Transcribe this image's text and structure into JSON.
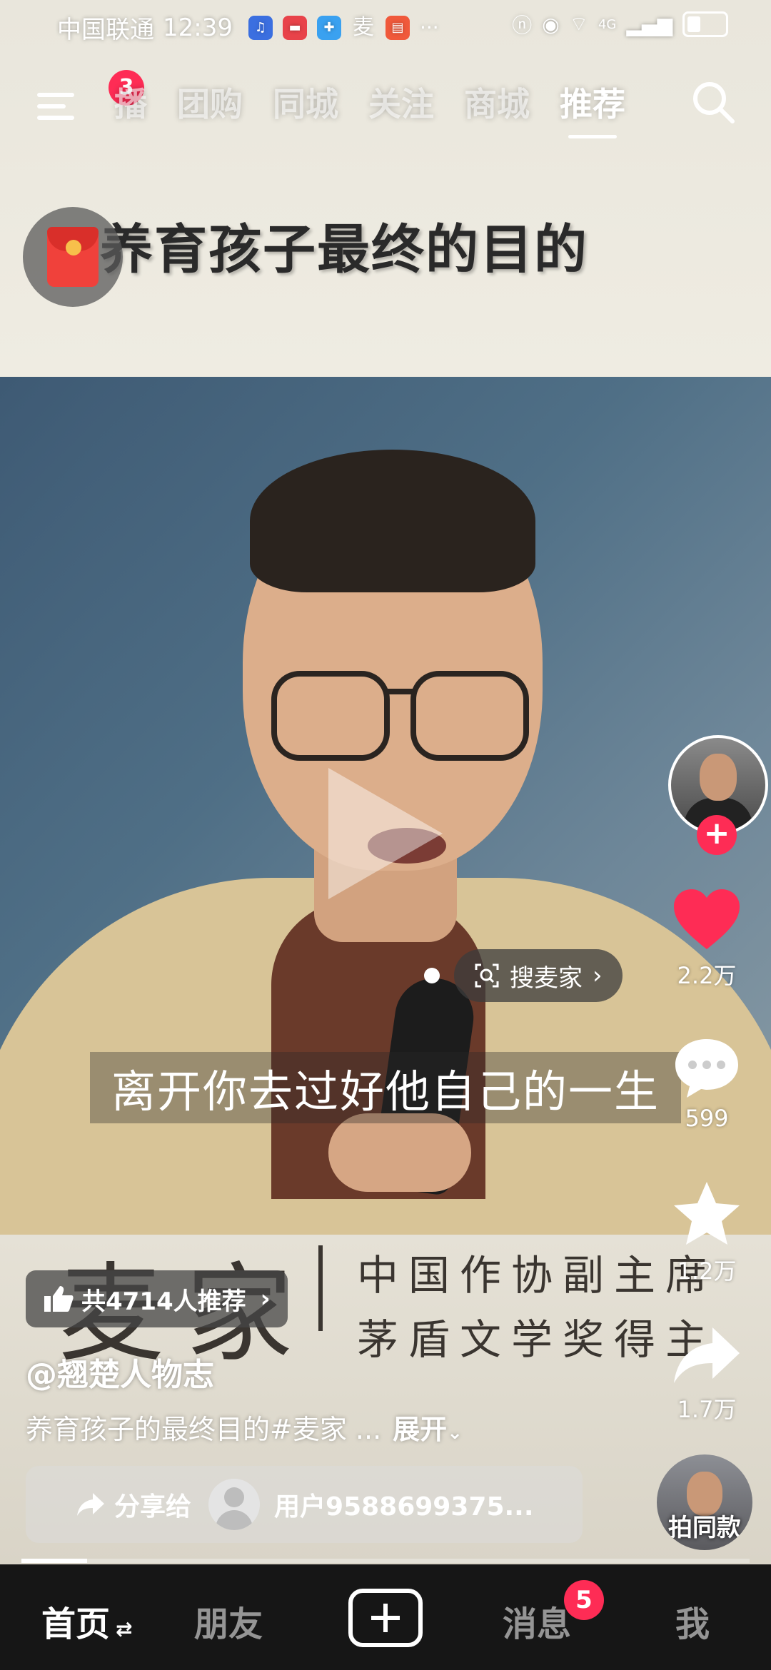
{
  "status_bar": {
    "carrier": "中国联通",
    "time": "12:39",
    "app_icons": [
      "music-app",
      "huawei-app",
      "map-app",
      "麦",
      "huawei-video-app"
    ],
    "more": "···",
    "network": "4G"
  },
  "top_nav": {
    "menu_badge": "3",
    "tabs": [
      "播",
      "团购",
      "同城",
      "关注",
      "商城",
      "推荐"
    ],
    "active_tab": "推荐"
  },
  "video": {
    "title": "养育孩子最终的目的",
    "search_tag": "搜麦家",
    "subtitle": "离开你去过好他自己的一生",
    "name_card": "麦家",
    "caption_line1": "中国作协副主席",
    "caption_line2": "茅盾文学奖得主"
  },
  "rail": {
    "likes": "2.2万",
    "comments": "599",
    "favorites": "1.2万",
    "shares": "1.7万",
    "shoot_same": "拍同款"
  },
  "info": {
    "recommend": "共4714人推荐",
    "author": "@翘楚人物志",
    "description": "养育孩子的最终目的#麦家 ...",
    "expand": "展开",
    "share_label": "分享给",
    "share_user": "用户9588699375..."
  },
  "progress": 0.09,
  "bottom_nav": {
    "home": "首页",
    "friends": "朋友",
    "messages": "消息",
    "messages_badge": "5",
    "me": "我"
  },
  "colors": {
    "accent": "#fe2c55",
    "nav_bg": "#161616"
  }
}
